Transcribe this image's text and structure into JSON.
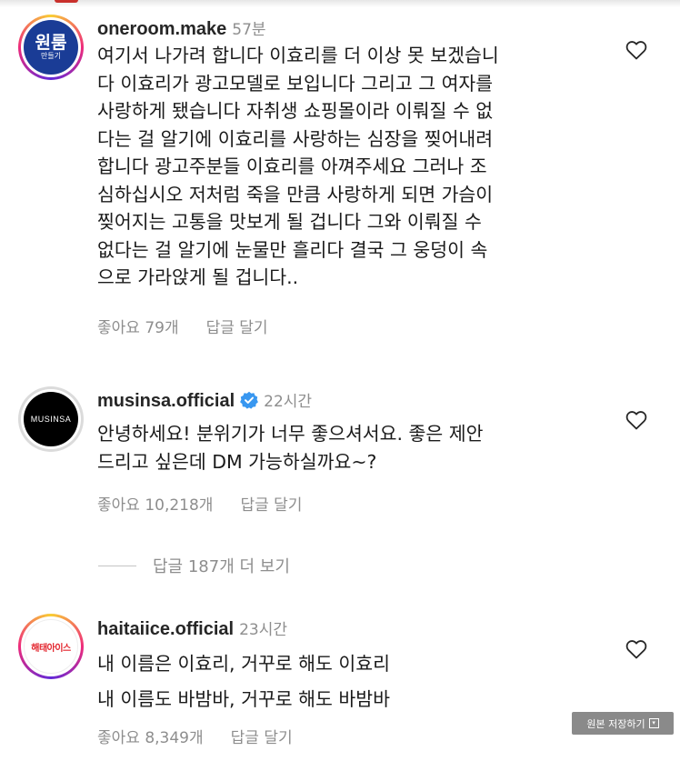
{
  "comments": [
    {
      "username": "oneroom.make",
      "time": "57분",
      "avatar_text": "원룸",
      "avatar_subtext": "만들기",
      "text": "여기서 나가려 합니다 이효리를 더 이상 못 보겠습니\n다 이효리가 광고모델로 보입니다 그리고 그 여자를\n사랑하게 됐습니다 자취생 쇼핑몰이라 이뤄질 수 없\n다는 걸 알기에 이효리를 사랑하는 심장을 찢어내려\n합니다 광고주분들 이효리를 아껴주세요 그러나 조\n심하십시오 저처럼 죽을 만큼 사랑하게 되면 가슴이\n찢어지는 고통을 맛보게 될 겁니다 그와 이뤄질 수\n없다는 걸 알기에 눈물만 흘리다 결국 그 웅덩이 속\n으로 가라앉게 될 겁니다..",
      "likes": "좋아요 79개",
      "reply": "답글 달기",
      "icon": "heart-outline-icon"
    },
    {
      "username": "musinsa.official",
      "time": "22시간",
      "avatar_text": "MUSINSA",
      "verified": true,
      "text": "안녕하세요! 분위기가 너무 좋으셔서요. 좋은 제안\n드리고 싶은데 DM 가능하실까요~?",
      "likes": "좋아요 10,218개",
      "reply": "답글 달기",
      "icon": "heart-outline-icon"
    },
    {
      "username": "haitaiice.official",
      "time": "23시간",
      "avatar_text": "해태아이스",
      "text": "내 이름은 이효리, 거꾸로 해도 이효리\n내 이름도 바밤바, 거꾸로 해도 바밤바",
      "likes": "좋아요 8,349개",
      "reply": "답글 달기",
      "icon": "heart-outline-icon"
    }
  ],
  "more_replies": "답글 187개 더 보기",
  "save_original": "원본 저장하기",
  "colors": {
    "text": "#1a1a1a",
    "muted": "#8e8e8e",
    "verified": "#3897f0",
    "haitai_red": "#e3262e"
  }
}
